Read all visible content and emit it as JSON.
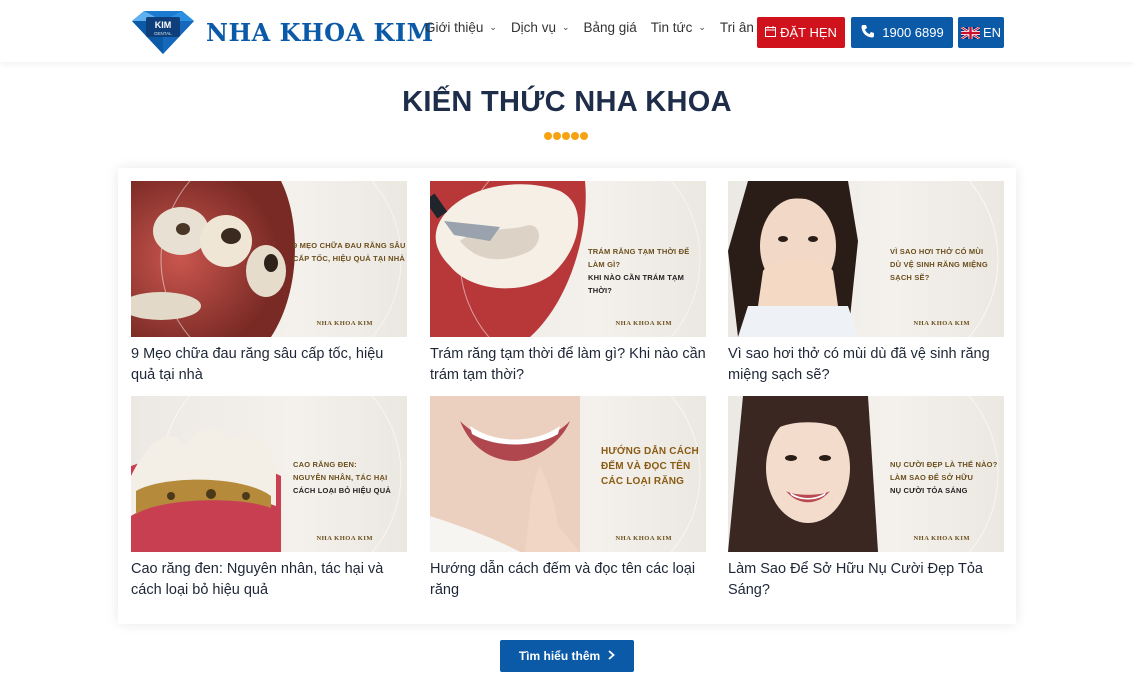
{
  "header": {
    "logo_badge": "KIM",
    "logo_badge_sub": "DENTAL",
    "logo_text": "NHA KHOA KIM",
    "nav": [
      {
        "label": "Giới thiệu",
        "dropdown": true
      },
      {
        "label": "Dịch vụ",
        "dropdown": true
      },
      {
        "label": "Bảng giá",
        "dropdown": false
      },
      {
        "label": "Tin tức",
        "dropdown": true
      },
      {
        "label": "Tri ân",
        "dropdown": true
      }
    ],
    "book_label": "ĐẶT HẸN",
    "phone_label": "1900 6899",
    "lang_label": "EN"
  },
  "section": {
    "title": "KIẾN THỨC NHA KHOA",
    "accent_color": "#f5a313"
  },
  "posts": [
    {
      "title": "9 Mẹo chữa đau răng sâu cấp tốc, hiệu quả tại nhà",
      "caption": [
        "9 MẸO CHỮA ĐAU RĂNG SÂU",
        "CẤP TỐC, HIỆU QUẢ TẠI NHÀ"
      ],
      "brand": "NHA KHOA KIM"
    },
    {
      "title": "Trám răng tạm thời để làm gì? Khi nào cần trám tạm thời?",
      "caption": [
        "TRÁM RĂNG TẠM THỜI ĐỂ LÀM GÌ?",
        "KHI NÀO CẦN TRÁM TẠM THỜI?"
      ],
      "brand": "NHA KHOA KIM"
    },
    {
      "title": "Vì sao hơi thở có mùi dù đã vệ sinh răng miệng sạch sẽ?",
      "caption": [
        "VÌ SAO HƠI THỞ CÓ MÙI",
        "DÙ VỆ SINH RĂNG MIỆNG SẠCH SẼ?"
      ],
      "brand": "NHA KHOA KIM"
    },
    {
      "title": "Cao răng đen: Nguyên nhân, tác hại và cách loại bỏ hiệu quả",
      "caption": [
        "CAO RĂNG ĐEN:",
        "NGUYÊN NHÂN, TÁC HẠI",
        "CÁCH LOẠI BỎ HIỆU QUẢ"
      ],
      "brand": "NHA KHOA KIM"
    },
    {
      "title": "Hướng dẫn cách đếm và đọc tên các loại răng",
      "caption": [
        "HƯỚNG DẪN CÁCH",
        "ĐẾM VÀ ĐỌC TÊN",
        "CÁC LOẠI RĂNG"
      ],
      "brand": "NHA KHOA KIM"
    },
    {
      "title": "Làm Sao Để Sở Hữu Nụ Cười Đẹp Tỏa Sáng?",
      "caption": [
        "NỤ CƯỜI ĐẸP LÀ THẾ NÀO?",
        "LÀM SAO ĐỂ SỞ HỮU",
        "NỤ CƯỜI TỎA SÁNG"
      ],
      "brand": "NHA KHOA KIM"
    }
  ],
  "more_button": {
    "label": "Tìm hiểu thêm"
  },
  "colors": {
    "primary": "#0b5aa8",
    "book": "#d0121c",
    "heading": "#1e2d4a"
  }
}
